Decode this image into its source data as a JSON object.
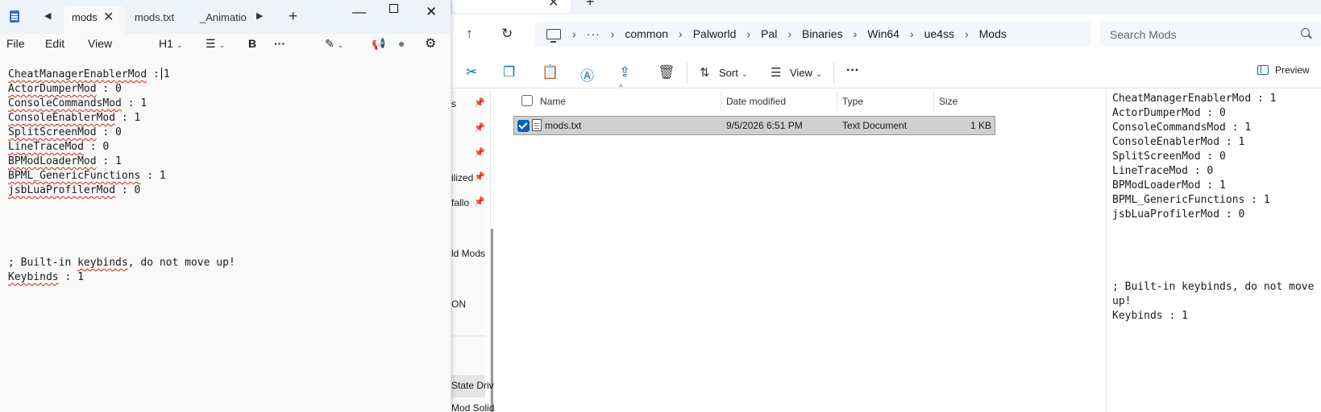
{
  "explorer": {
    "breadcrumb": {
      "overflow": "···",
      "items": [
        "common",
        "Palworld",
        "Pal",
        "Binaries",
        "Win64",
        "ue4ss",
        "Mods"
      ]
    },
    "search_placeholder": "Search Mods",
    "toolbar": {
      "sort_label": "Sort",
      "view_label": "View",
      "more_label": "···",
      "preview_label": "Preview"
    },
    "nav_pane": {
      "items": [
        "s",
        "",
        "",
        "ilized",
        "fallo",
        "ld Mods",
        "ON",
        "",
        "State Driv",
        "Mod Solid"
      ]
    },
    "columns": {
      "name": "Name",
      "date_modified": "Date modified",
      "type": "Type",
      "size": "Size"
    },
    "files": [
      {
        "name": "mods.txt",
        "date_modified": "9/5/2026 6:51 PM",
        "type": "Text Document",
        "size": "1 KB",
        "selected": true
      }
    ],
    "preview_text": "CheatManagerEnablerMod : 1\nActorDumperMod : 0\nConsoleCommandsMod : 1\nConsoleEnablerMod : 1\nSplitScreenMod : 0\nLineTraceMod : 0\nBPModLoaderMod : 1\nBPML_GenericFunctions : 1\njsbLuaProfilerMod : 0\n\n\n\n\n; Built-in keybinds, do not move up!\nKeybinds : 1"
  },
  "notepad": {
    "tabs": [
      {
        "label": "mods",
        "active": true
      },
      {
        "label": "mods.txt",
        "active": false
      },
      {
        "label": "_Animation",
        "active": false
      }
    ],
    "window": {
      "minimize": "—",
      "close": "✕"
    },
    "menu": {
      "file": "File",
      "edit": "Edit",
      "view": "View"
    },
    "format": {
      "heading": "H1",
      "bold": "B",
      "more": "···"
    },
    "lines": {
      "l1_key": "CheatManagerEnablerMod",
      "l1_sep": " :",
      "l1_val": "1",
      "l2_key": "ActorDumperMod",
      "l2_val": " : 0",
      "l3_key": "ConsoleCommandsMod",
      "l3_val": " : 1",
      "l4_key": "ConsoleEnablerMod",
      "l4_val": " : 1",
      "l5_key": "SplitScreenMod",
      "l5_val": " : 0",
      "l6_key": "LineTraceMod",
      "l6_val": " : 0",
      "l7_key": "BPModLoaderMod",
      "l7_val": " : 1",
      "l8_key": "BPML_GenericFunctions",
      "l8_val": " : 1",
      "l9_key": "jsbLuaProfilerMod",
      "l9_val": " : 0",
      "comment_pre": "; Built-in ",
      "comment_word": "keybinds",
      "comment_post": ", do not move up!",
      "last_key": "Keybinds",
      "last_val": " : 1"
    }
  }
}
